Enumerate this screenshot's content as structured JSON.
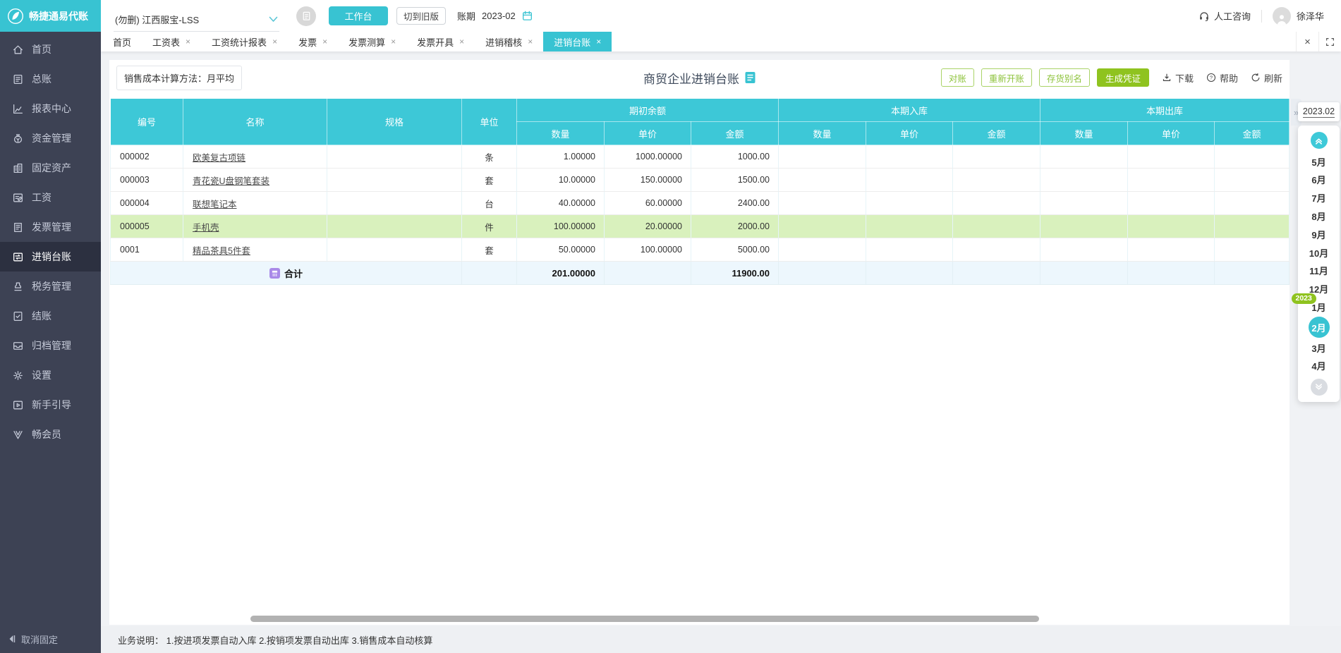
{
  "topbar": {
    "logo_text": "畅捷通易代账",
    "account": "(勿删) 江西服宝-LSS",
    "workbench": "工作台",
    "switch_old": "切到旧版",
    "period_label": "账期",
    "period_value": "2023-02",
    "support": "人工咨询",
    "user": "徐泽华"
  },
  "tabs": [
    {
      "label": "首页",
      "closable": false,
      "active": false
    },
    {
      "label": "工资表",
      "closable": true,
      "active": false
    },
    {
      "label": "工资统计报表",
      "closable": true,
      "active": false
    },
    {
      "label": "发票",
      "closable": true,
      "active": false
    },
    {
      "label": "发票测算",
      "closable": true,
      "active": false
    },
    {
      "label": "发票开具",
      "closable": true,
      "active": false
    },
    {
      "label": "进销稽核",
      "closable": true,
      "active": false
    },
    {
      "label": "进销台账",
      "closable": true,
      "active": true
    }
  ],
  "sidebar": {
    "items": [
      {
        "icon": "home",
        "label": "首页",
        "active": false
      },
      {
        "icon": "ledger",
        "label": "总账",
        "active": false
      },
      {
        "icon": "report",
        "label": "报表中心",
        "active": false
      },
      {
        "icon": "fund",
        "label": "资金管理",
        "active": false
      },
      {
        "icon": "asset",
        "label": "固定资产",
        "active": false
      },
      {
        "icon": "salary",
        "label": "工资",
        "active": false
      },
      {
        "icon": "invoice",
        "label": "发票管理",
        "active": false
      },
      {
        "icon": "inout",
        "label": "进销台账",
        "active": true
      },
      {
        "icon": "tax",
        "label": "税务管理",
        "active": false
      },
      {
        "icon": "settle",
        "label": "结账",
        "active": false
      },
      {
        "icon": "archive",
        "label": "归档管理",
        "active": false
      },
      {
        "icon": "settings",
        "label": "设置",
        "active": false
      },
      {
        "icon": "guide",
        "label": "新手引导",
        "active": false
      },
      {
        "icon": "member",
        "label": "畅会员",
        "active": false
      }
    ],
    "footer": "取消固定"
  },
  "toolbar": {
    "cost_label": "销售成本计算方法：",
    "cost_value": "月平均",
    "title": "商贸企业进销台账",
    "actions": [
      "对账",
      "重新开账",
      "存货别名"
    ],
    "primary": "生成凭证",
    "download": "下载",
    "help": "帮助",
    "refresh": "刷新"
  },
  "table": {
    "columns": [
      "编号",
      "名称",
      "规格",
      "单位"
    ],
    "groups": [
      "期初余额",
      "本期入库",
      "本期出库"
    ],
    "subcolumns": [
      "数量",
      "单价",
      "金额"
    ],
    "rows": [
      {
        "code": "000002",
        "name": "欧美复古项链",
        "spec": "",
        "unit": "条",
        "qty": "1.00000",
        "price": "1000.00000",
        "amount": "1000.00",
        "highlight": false
      },
      {
        "code": "000003",
        "name": "青花瓷U盘钢笔套装",
        "spec": "",
        "unit": "套",
        "qty": "10.00000",
        "price": "150.00000",
        "amount": "1500.00",
        "highlight": false
      },
      {
        "code": "000004",
        "name": "联想笔记本",
        "spec": "",
        "unit": "台",
        "qty": "40.00000",
        "price": "60.00000",
        "amount": "2400.00",
        "highlight": false
      },
      {
        "code": "000005",
        "name": "手机壳",
        "spec": "",
        "unit": "件",
        "qty": "100.00000",
        "price": "20.00000",
        "amount": "2000.00",
        "highlight": true
      },
      {
        "code": "0001",
        "name": "精品茶具5件套",
        "spec": "",
        "unit": "套",
        "qty": "50.00000",
        "price": "100.00000",
        "amount": "5000.00",
        "highlight": false
      }
    ],
    "total": {
      "label": "合计",
      "qty": "201.00000",
      "amount": "11900.00"
    }
  },
  "period_panel": {
    "current": "2023.02",
    "months": [
      {
        "label": "5月",
        "selected": false,
        "badge": ""
      },
      {
        "label": "6月",
        "selected": false,
        "badge": ""
      },
      {
        "label": "7月",
        "selected": false,
        "badge": ""
      },
      {
        "label": "8月",
        "selected": false,
        "badge": ""
      },
      {
        "label": "9月",
        "selected": false,
        "badge": ""
      },
      {
        "label": "10月",
        "selected": false,
        "badge": ""
      },
      {
        "label": "11月",
        "selected": false,
        "badge": ""
      },
      {
        "label": "12月",
        "selected": false,
        "badge": ""
      },
      {
        "label": "1月",
        "selected": false,
        "badge": "2023"
      },
      {
        "label": "2月",
        "selected": true,
        "badge": ""
      },
      {
        "label": "3月",
        "selected": false,
        "badge": ""
      },
      {
        "label": "4月",
        "selected": false,
        "badge": ""
      }
    ]
  },
  "statusbar": {
    "text": "业务说明： 1.按进项发票自动入库   2.按销项发票自动出库   3.销售成本自动核算"
  },
  "colors": {
    "accent": "#38c3d2",
    "table_header": "#3dc8d7",
    "lime_button": "#8fc31f",
    "highlight_row": "#d9f1bd",
    "sidebar_bg": "#3d4254"
  }
}
